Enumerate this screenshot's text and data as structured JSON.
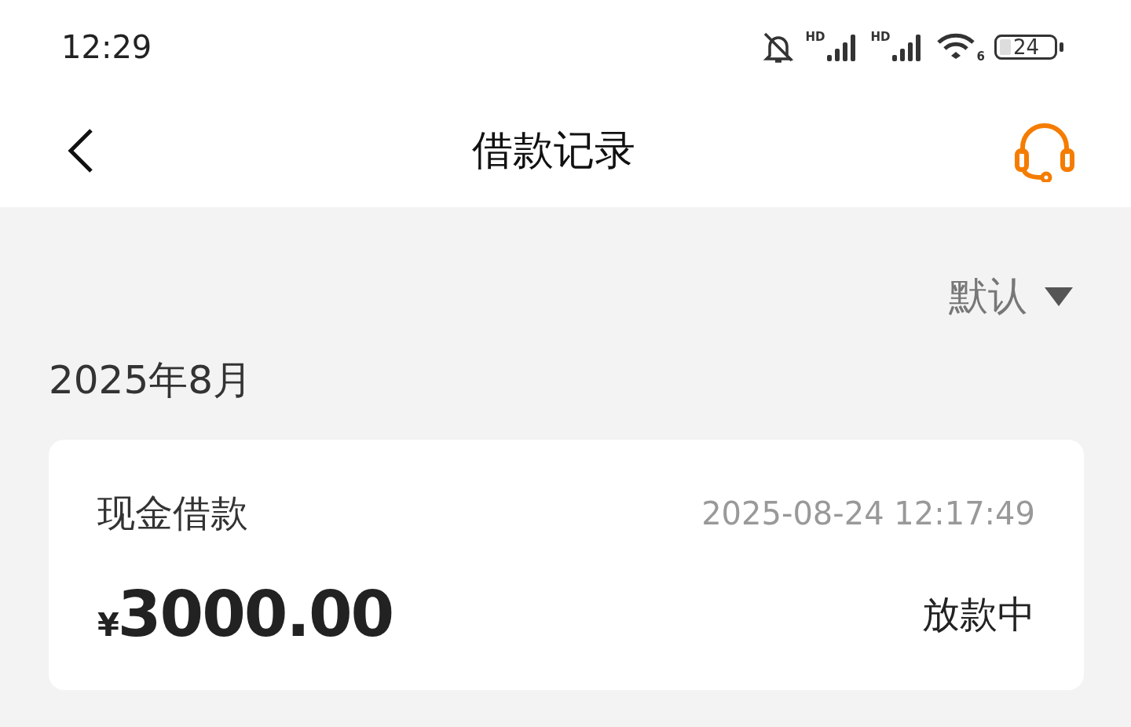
{
  "status_bar": {
    "time": "12:29",
    "sim_labels": [
      "HD",
      "HD"
    ],
    "wifi_label": "6",
    "battery": "24"
  },
  "header": {
    "title": "借款记录"
  },
  "sort": {
    "label": "默认"
  },
  "groups": [
    {
      "month": "2025年8月",
      "records": [
        {
          "type": "现金借款",
          "time": "2025-08-24 12:17:49",
          "currency": "¥",
          "amount": "3000.00",
          "status": "放款中"
        }
      ]
    }
  ]
}
